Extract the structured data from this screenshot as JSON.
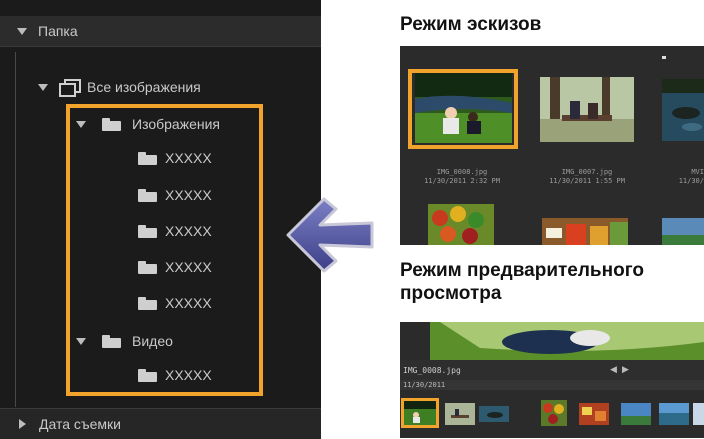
{
  "folder_tree": {
    "header": "Папка",
    "all_images": "Все изображения",
    "images_folder": "Изображения",
    "image_subfolders": [
      "XXXXX",
      "XXXXX",
      "XXXXX",
      "XXXXX",
      "XXXXX"
    ],
    "video_folder": "Видео",
    "video_subfolders": [
      "XXXXX"
    ],
    "footer": "Дата съемки"
  },
  "thumbnail_mode": {
    "title": "Режим эскизов",
    "items": [
      {
        "name": "IMG_0008.jpg",
        "date": "11/30/2011 2:32 PM"
      },
      {
        "name": "IMG_0007.jpg",
        "date": "11/30/2011 1:55 PM"
      },
      {
        "name": "MVI",
        "date": "11/30/"
      }
    ]
  },
  "preview_mode": {
    "title": "Режим предварительного просмотра",
    "filename": "IMG_0008.jpg",
    "date": "11/30/2011"
  },
  "colors": {
    "highlight": "#f1a32b",
    "arrow": "#5b5ea6",
    "panel": "#1b1b1b"
  }
}
